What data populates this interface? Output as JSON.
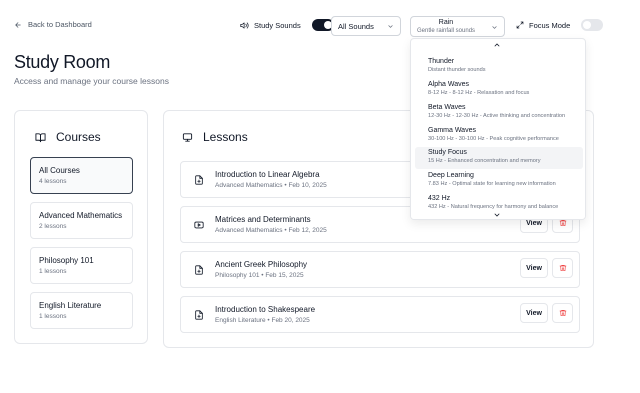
{
  "nav": {
    "back_label": "Back to Dashboard"
  },
  "header": {
    "title": "Study Room",
    "subtitle": "Access and manage your course lessons"
  },
  "controls": {
    "study_sounds_label": "Study Sounds",
    "study_sounds_on": true,
    "sound_filter": "All Sounds",
    "sound_selected_title": "Rain",
    "sound_selected_subtitle": "Gentle rainfall sounds",
    "focus_mode_label": "Focus Mode",
    "focus_mode_on": false
  },
  "courses": {
    "heading": "Courses",
    "items": [
      {
        "name": "All Courses",
        "count": "4 lessons",
        "active": true
      },
      {
        "name": "Advanced Mathematics",
        "count": "2 lessons",
        "active": false
      },
      {
        "name": "Philosophy 101",
        "count": "1 lessons",
        "active": false
      },
      {
        "name": "English Literature",
        "count": "1 lessons",
        "active": false
      }
    ]
  },
  "lessons": {
    "heading": "Lessons",
    "view_label": "View",
    "items": [
      {
        "title": "Introduction to Linear Algebra",
        "meta": "Advanced Mathematics • Feb 10, 2025",
        "icon": "file-icon"
      },
      {
        "title": "Matrices and Determinants",
        "meta": "Advanced Mathematics • Feb 12, 2025",
        "icon": "video-icon"
      },
      {
        "title": "Ancient Greek Philosophy",
        "meta": "Philosophy 101 • Feb 15, 2025",
        "icon": "file-icon"
      },
      {
        "title": "Introduction to Shakespeare",
        "meta": "English Literature • Feb 20, 2025",
        "icon": "file-icon"
      }
    ]
  },
  "sound_dropdown": {
    "items": [
      {
        "name": "Thunder",
        "desc": "Distant thunder sounds"
      },
      {
        "name": "Alpha Waves",
        "desc": "8-12 Hz - 8-12 Hz - Relaxation and focus"
      },
      {
        "name": "Beta Waves",
        "desc": "12-30 Hz - 12-30 Hz - Active thinking and concentration"
      },
      {
        "name": "Gamma Waves",
        "desc": "30-100 Hz - 30-100 Hz - Peak cognitive performance"
      },
      {
        "name": "Study Focus",
        "desc": "15 Hz - Enhanced concentration and memory",
        "highlighted": true
      },
      {
        "name": "Deep Learning",
        "desc": "7.83 Hz - Optimal state for learning new information"
      },
      {
        "name": "432 Hz",
        "desc": "432 Hz - Natural frequency for harmony and balance"
      }
    ]
  },
  "colors": {
    "accent_dark": "#111827",
    "border": "#e5e7eb",
    "muted_text": "#6b7280",
    "delete_red": "#ef4444"
  }
}
